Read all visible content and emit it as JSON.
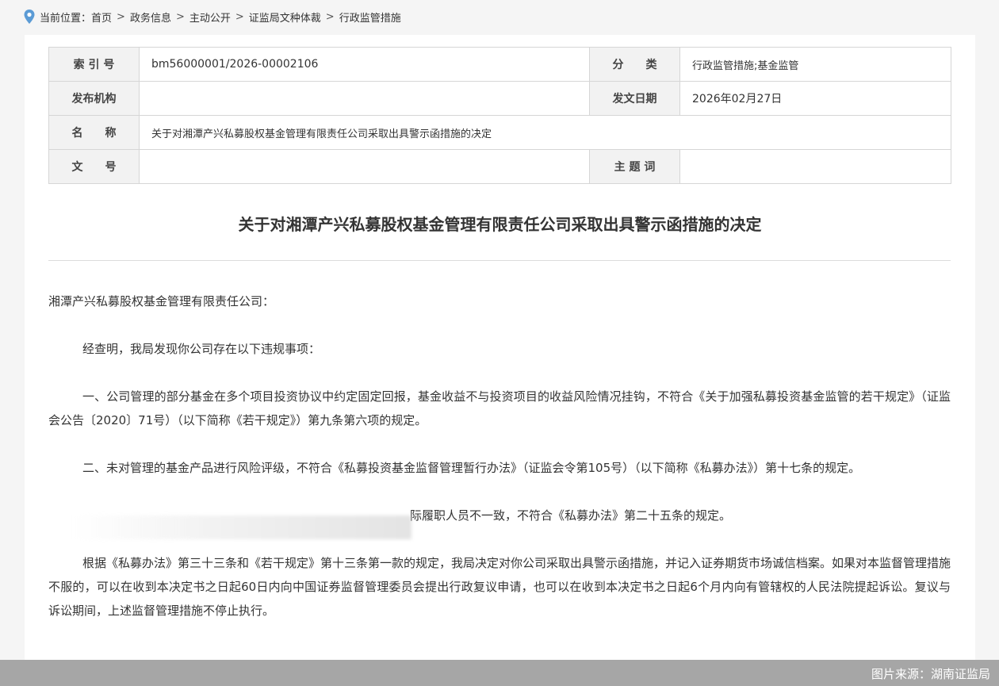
{
  "breadcrumb": {
    "prefix": "当前位置：",
    "items": [
      "首页",
      "政务信息",
      "主动公开",
      "证监局文种体裁",
      "行政监管措施"
    ],
    "separator": ">"
  },
  "meta_table": {
    "index_label": "索 引 号",
    "index_value": "bm56000001/2026-00002106",
    "category_label": "分　　类",
    "category_value": "行政监管措施;基金监管",
    "publisher_label": "发布机构",
    "publisher_value": "",
    "date_label": "发文日期",
    "date_value": "2026年02月27日",
    "name_label": "名　　称",
    "name_value": "关于对湘潭产兴私募股权基金管理有限责任公司采取出具警示函措施的决定",
    "docno_label": "文　　号",
    "docno_value": "",
    "subject_label": "主 题 词",
    "subject_value": ""
  },
  "document": {
    "title": "关于对湘潭产兴私募股权基金管理有限责任公司采取出具警示函措施的决定",
    "salutation": "湘潭产兴私募股权基金管理有限责任公司：",
    "intro": "经查明，我局发现你公司存在以下违规事项：",
    "item1": "一、公司管理的部分基金在多个项目投资协议中约定固定回报，基金收益不与投资项目的收益风险情况挂钩，不符合《关于加强私募投资基金监管的若干规定》（证监会公告〔2020〕71号）（以下简称《若干规定》）第九条第六项的规定。",
    "item2": "二、未对管理的基金产品进行风险评级，不符合《私募投资基金监督管理暂行办法》（证监会令第105号）（以下简称《私募办法》）第十七条的规定。",
    "item3_visible": "际履职人员不一致，不符合《私募办法》第二十五条的规定。",
    "decision": "根据《私募办法》第三十三条和《若干规定》第十三条第一款的规定，我局决定对你公司采取出具警示函措施，并记入证券期货市场诚信档案。如果对本监督管理措施不服的，可以在收到本决定书之日起60日内向中国证券监督管理委员会提出行政复议申请，也可以在收到本决定书之日起6个月内向有管辖权的人民法院提起诉讼。复议与诉讼期间，上述监督管理措施不停止执行。"
  },
  "footer": {
    "source": "图片来源：湖南证监局"
  },
  "colors": {
    "accent_icon": "#5b9bd5",
    "footer_bar": "#a6a6a6"
  },
  "icons": {
    "location": "map-pin-icon"
  }
}
